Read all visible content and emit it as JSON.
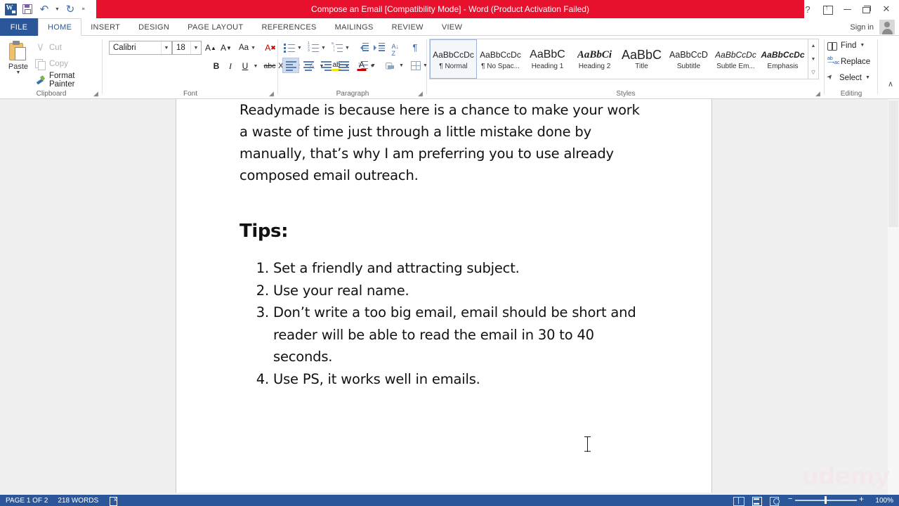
{
  "titlebar": {
    "title": "Compose an Email [Compatibility Mode]  -  Word (Product Activation Failed)",
    "quick_access": [
      {
        "name": "word-app-icon",
        "label": "W"
      },
      {
        "name": "save-icon",
        "label": "Save"
      },
      {
        "name": "undo-icon",
        "label": "Undo"
      },
      {
        "name": "redo-icon",
        "label": "Redo"
      },
      {
        "name": "customize-qat-icon",
        "label": "Customize Quick Access Toolbar"
      }
    ],
    "help_label": "?",
    "ribbon_display_label": "Ribbon Display Options",
    "minimize_label": "Minimize",
    "restore_label": "Restore Down",
    "close_label": "✕",
    "signin_label": "Sign in",
    "accent_red": "#e8112d",
    "accent_blue": "#2b579a"
  },
  "tabs": [
    {
      "label": "FILE",
      "active": false
    },
    {
      "label": "HOME",
      "active": true
    },
    {
      "label": "INSERT",
      "active": false
    },
    {
      "label": "DESIGN",
      "active": false
    },
    {
      "label": "PAGE LAYOUT",
      "active": false
    },
    {
      "label": "REFERENCES",
      "active": false
    },
    {
      "label": "MAILINGS",
      "active": false
    },
    {
      "label": "REVIEW",
      "active": false
    },
    {
      "label": "VIEW",
      "active": false
    }
  ],
  "ribbon": {
    "clipboard": {
      "group_label": "Clipboard",
      "paste_label": "Paste",
      "cut_label": "Cut",
      "copy_label": "Copy",
      "format_painter_label": "Format Painter"
    },
    "font": {
      "group_label": "Font",
      "font_name": "Calibri",
      "font_size": "18",
      "grow_font_label": "A",
      "shrink_font_label": "A",
      "change_case_label": "Aa",
      "clear_formatting_label": "Clear All Formatting",
      "bold_label": "B",
      "italic_label": "I",
      "underline_label": "U",
      "strikethrough_label": "abc",
      "subscript_label": "X",
      "superscript_label": "X",
      "text_effects_label": "A",
      "highlight_label": "ab",
      "font_color_label": "A",
      "highlight_color": "#f5e400",
      "font_color": "#c00000"
    },
    "paragraph": {
      "group_label": "Paragraph",
      "bullets_label": "Bullets",
      "numbering_label": "Numbering",
      "multilevel_label": "Multilevel List",
      "decrease_indent_label": "Decrease Indent",
      "increase_indent_label": "Increase Indent",
      "sort_label": "Sort",
      "show_marks_label": "¶",
      "align_left_label": "Align Left",
      "center_label": "Center",
      "align_right_label": "Align Right",
      "justify_label": "Justify",
      "line_spacing_label": "Line and Paragraph Spacing",
      "shading_label": "Shading",
      "borders_label": "Borders"
    },
    "styles": {
      "group_label": "Styles",
      "items": [
        {
          "preview": "AaBbCcDc",
          "name": "¶ Normal",
          "selected": true
        },
        {
          "preview": "AaBbCcDc",
          "name": "¶ No Spac...",
          "selected": false
        },
        {
          "preview": "AaBbC",
          "name": "Heading 1",
          "selected": false
        },
        {
          "preview": "AaBbCi",
          "name": "Heading 2",
          "selected": false
        },
        {
          "preview": "AaBbC",
          "name": "Title",
          "selected": false
        },
        {
          "preview": "AaBbCcD",
          "name": "Subtitle",
          "selected": false
        },
        {
          "preview": "AaBbCcDc",
          "name": "Subtle Em...",
          "selected": false
        },
        {
          "preview": "AaBbCcDc",
          "name": "Emphasis",
          "selected": false
        }
      ]
    },
    "editing": {
      "group_label": "Editing",
      "find_label": "Find",
      "replace_label": "Replace",
      "select_label": "Select"
    },
    "collapse_ribbon_label": "∧"
  },
  "document": {
    "paragraph": "Readymade is because here is a chance to make your work a waste of time just through a little mistake done by manually, that’s why I am preferring you to use already composed email outreach.",
    "tips_heading": "Tips:",
    "tips": [
      "Set a friendly and attracting subject.",
      "Use your real name.",
      "Don’t write a too big email, email should be short and reader will be able to read the email in 30 to 40 seconds.",
      "Use PS, it works well in emails."
    ],
    "watermark": "udemy"
  },
  "statusbar": {
    "page_info": "PAGE 1 OF 2",
    "word_count": "218 WORDS",
    "proofing_label": "Proofing errors",
    "read_mode_label": "Read Mode",
    "print_layout_label": "Print Layout",
    "web_layout_label": "Web Layout",
    "zoom_out_label": "−",
    "zoom_in_label": "+",
    "zoom_level": "100%"
  }
}
